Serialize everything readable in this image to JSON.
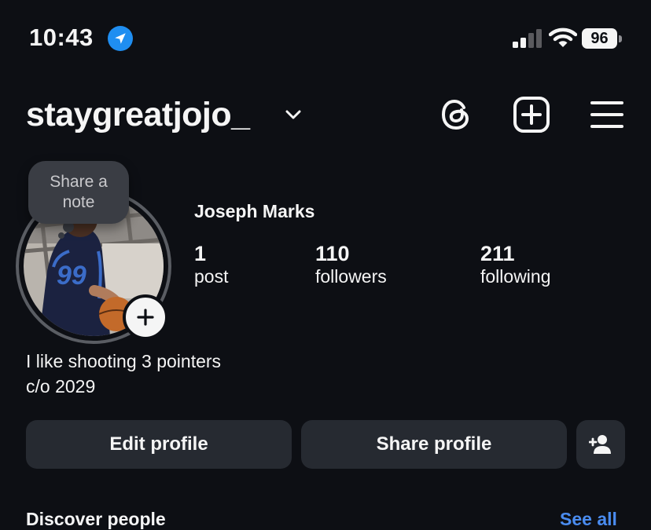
{
  "status_bar": {
    "time": "10:43",
    "battery": "96",
    "icons": [
      "location-arrow-icon",
      "cellular-signal-icon",
      "wifi-icon",
      "battery-icon"
    ]
  },
  "header": {
    "username": "staygreatjojo_",
    "icons": [
      "chevron-down-icon",
      "threads-icon",
      "create-post-icon",
      "menu-icon"
    ]
  },
  "note": {
    "line1": "Share a",
    "line2": "note"
  },
  "profile": {
    "full_name": "Joseph Marks",
    "avatar_jersey_number": "99",
    "stats": [
      {
        "value": "1",
        "label": "post"
      },
      {
        "value": "110",
        "label": "followers"
      },
      {
        "value": "211",
        "label": "following"
      }
    ],
    "bio": [
      "I like shooting 3 pointers",
      "c/o 2029"
    ]
  },
  "actions": {
    "edit_profile": "Edit profile",
    "share_profile": "Share profile",
    "add_person_icon": "add-person-icon"
  },
  "discover": {
    "title": "Discover people",
    "see_all": "See all"
  },
  "colors": {
    "background": "#0d0f14",
    "button": "#262a31",
    "accent": "#4a8cf0",
    "location": "#1f8ef1"
  }
}
